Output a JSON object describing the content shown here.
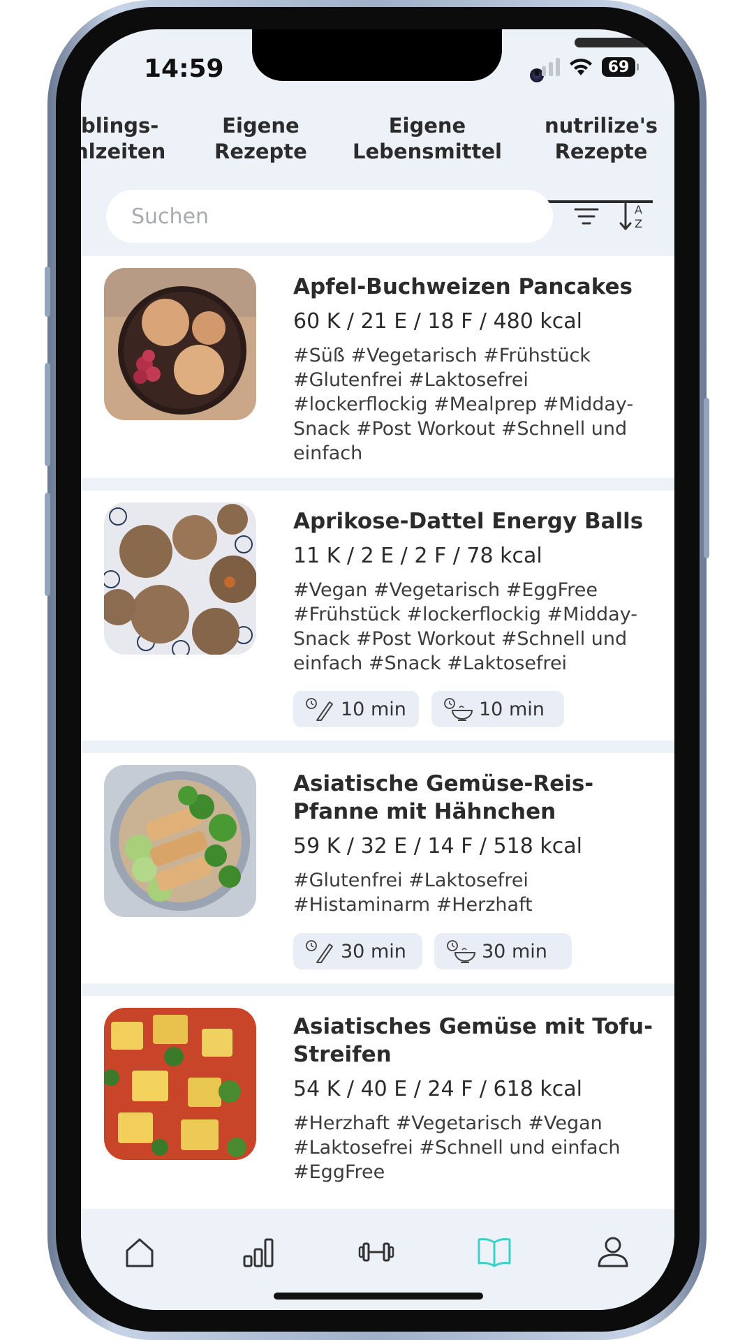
{
  "status_bar": {
    "time": "14:59",
    "battery": "69"
  },
  "tabs": [
    {
      "line1": "blings-",
      "line2": "nlzeiten",
      "active": false
    },
    {
      "line1": "Eigene",
      "line2": "Rezepte",
      "active": false
    },
    {
      "line1": "Eigene",
      "line2": "Lebensmittel",
      "active": false
    },
    {
      "line1": "nutrilize's",
      "line2": "Rezepte",
      "active": true
    }
  ],
  "search": {
    "placeholder": "Suchen",
    "value": ""
  },
  "icons": {
    "filter": "filter-icon",
    "sort": "sort-az-icon",
    "prep": "prep-time-icon",
    "cook": "cook-time-icon"
  },
  "recipes": [
    {
      "title": "Apfel-Buchweizen Pancakes",
      "macros": "60 K / 21 E / 18 F / 480 kcal",
      "tags": "#Süß #Vegetarisch #Frühstück #Glutenfrei #Laktosefrei #lockerflockig #Mealprep #Midday-Snack #Post Workout #Schnell und einfach"
    },
    {
      "title": "Aprikose-Dattel Energy Balls",
      "macros": "11 K / 2 E / 2 F / 78 kcal",
      "tags": "#Vegan #Vegetarisch #EggFree #Frühstück #lockerflockig #Midday-Snack #Post Workout #Schnell und einfach #Snack #Laktosefrei",
      "prep_time": "10 min",
      "cook_time": "10 min"
    },
    {
      "title": "Asiatische Gemüse-Reis-Pfanne mit Hähnchen",
      "macros": "59 K / 32 E / 14 F / 518 kcal",
      "tags": "#Glutenfrei #Laktosefrei #Histaminarm #Herzhaft",
      "prep_time": "30 min",
      "cook_time": "30 min"
    },
    {
      "title": "Asiatisches Gemüse mit Tofu-Streifen",
      "macros": "54 K / 40 E / 24 F / 618 kcal",
      "tags": "#Herzhaft #Vegetarisch #Vegan #Laktosefrei #Schnell und einfach #EggFree"
    }
  ],
  "bottom_nav": [
    {
      "icon": "home-icon",
      "active": false
    },
    {
      "icon": "stats-icon",
      "active": false
    },
    {
      "icon": "dumbbell-icon",
      "active": false
    },
    {
      "icon": "book-icon",
      "active": true
    },
    {
      "icon": "profile-icon",
      "active": false
    }
  ],
  "colors": {
    "accent": "#3fd1c9",
    "background": "#edf1f8",
    "text": "#2b2b2b"
  }
}
